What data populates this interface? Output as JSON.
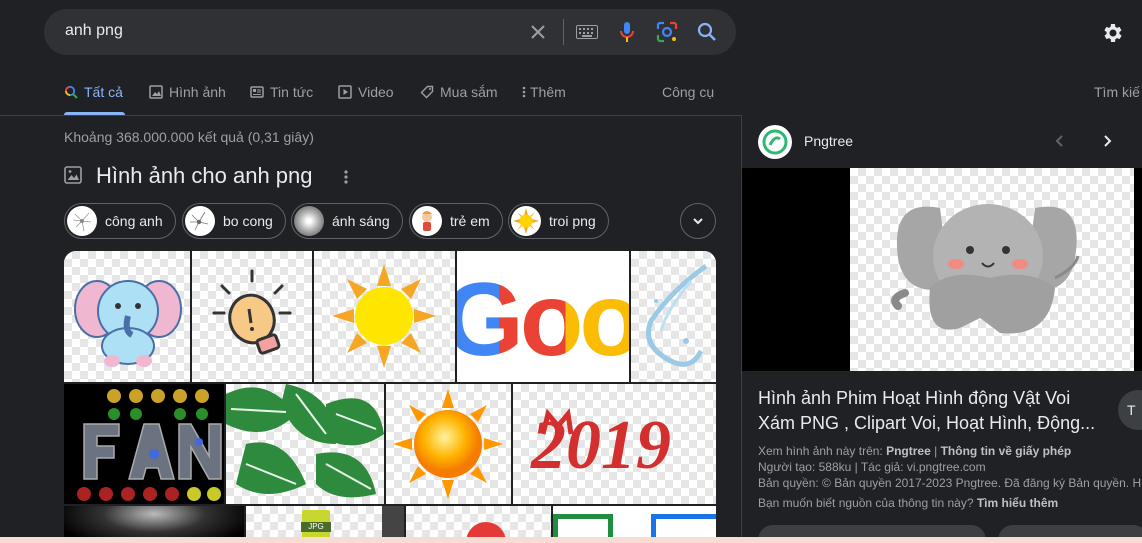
{
  "search": {
    "query": "anh png"
  },
  "tabs": [
    {
      "label": "Tất cả",
      "icon": "search-icon",
      "active": true
    },
    {
      "label": "Hình ảnh",
      "icon": "image-icon"
    },
    {
      "label": "Tin tức",
      "icon": "news-icon"
    },
    {
      "label": "Video",
      "icon": "video-icon"
    },
    {
      "label": "Mua sắm",
      "icon": "tag-icon"
    },
    {
      "label": "Thêm",
      "icon": "more-vert-icon"
    }
  ],
  "tools_label": "Công cụ",
  "search_right_label": "Tìm kiế",
  "stats": "Khoảng 368.000.000 kết quả (0,31 giây)",
  "images_section": {
    "title": "Hình ảnh cho anh png"
  },
  "chips": [
    {
      "label": "công anh",
      "icon": "dandelion-icon"
    },
    {
      "label": "bo cong",
      "icon": "dandelion-icon"
    },
    {
      "label": "ánh sáng",
      "icon": "light-icon"
    },
    {
      "label": "trẻ em",
      "icon": "child-icon"
    },
    {
      "label": "troi png",
      "icon": "sun-icon"
    }
  ],
  "grid": {
    "google_text": "Goog",
    "year_text": "2019",
    "jpg_label": "JPG"
  },
  "panel": {
    "source": "Pngtree",
    "title": "Hình ảnh Phim Hoạt Hình động Vật Voi Xám PNG , Clipart Voi, Hoạt Hình, Động...",
    "view_on_prefix": "Xem hình ảnh này trên:",
    "view_on_site": "Pngtree",
    "separator": "|",
    "license_link": "Thông tin về giấy phép",
    "creator": "Người tạo: 588ku | Tác giả: vi.pngtree.com",
    "copyright": "Bản quyền: © Bản quyền 2017-2023 Pngtree. Đã đăng ký Bản quyền. H",
    "learn_prefix": "Bạn muốn biết nguồn của thông tin này?",
    "learn_more": "Tìm hiểu thêm",
    "side_button": "T"
  },
  "colors": {
    "background": "#202124",
    "accent": "#8ab4f8",
    "text_primary": "#e8eaed",
    "text_secondary": "#9aa0a6"
  }
}
